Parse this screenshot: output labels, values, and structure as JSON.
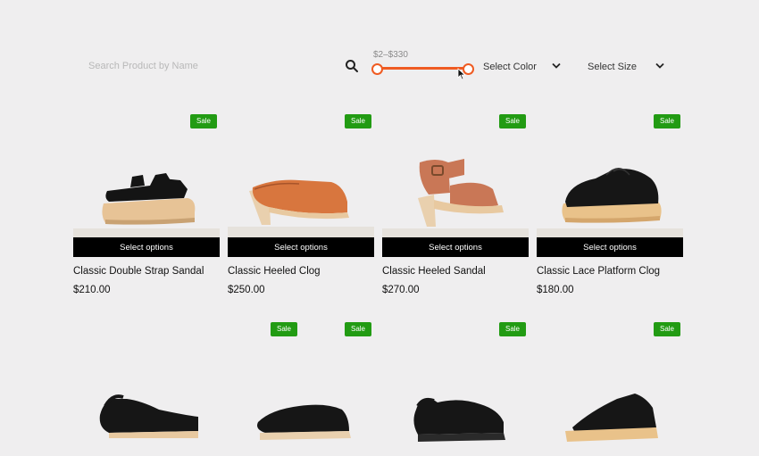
{
  "filters": {
    "search_placeholder": "Search Product by Name",
    "price_range_label": "$2–$330",
    "price_min": 2,
    "price_max": 330,
    "color_label": "Select Color",
    "size_label": "Select Size",
    "accent_color": "#ef5b22"
  },
  "products": [
    {
      "badge": "Sale",
      "button": "Select options",
      "title": "Classic Double Strap Sandal",
      "price": "$210.00"
    },
    {
      "badge": "Sale",
      "button": "Select options",
      "title": "Classic Heeled Clog",
      "price": "$250.00"
    },
    {
      "badge": "Sale",
      "button": "Select options",
      "title": "Classic Heeled Sandal",
      "price": "$270.00"
    },
    {
      "badge": "Sale",
      "button": "Select options",
      "title": "Classic Lace Platform Clog",
      "price": "$180.00"
    },
    {
      "badge": "Sale"
    },
    {
      "badge": "Sale"
    },
    {
      "badge": "Sale"
    },
    {
      "badge": "Sale"
    }
  ],
  "colors": {
    "badge": "#229b13",
    "button": "#000000",
    "background": "#efeeef"
  }
}
